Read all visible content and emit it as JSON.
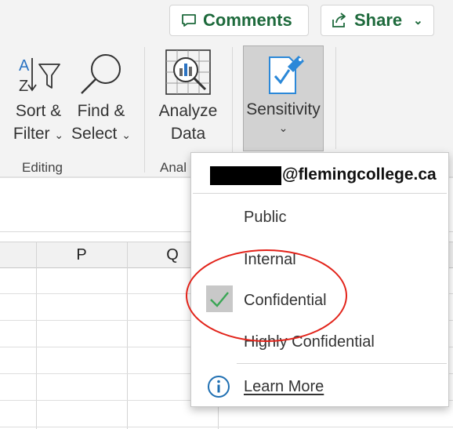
{
  "header": {
    "comments_label": "Comments",
    "share_label": "Share"
  },
  "ribbon": {
    "sort_filter": {
      "line1": "Sort &",
      "line2": "Filter"
    },
    "find_select": {
      "line1": "Find &",
      "line2": "Select"
    },
    "analyze_data": {
      "line1": "Analyze",
      "line2": "Data"
    },
    "sensitivity": {
      "label": "Sensitivity"
    },
    "groups": {
      "editing": "Editing",
      "analysis": "Anal"
    }
  },
  "sheet": {
    "columns": [
      "P",
      "Q"
    ]
  },
  "sensitivity_menu": {
    "email_visible": "@flemingcollege.ca",
    "items": [
      {
        "label": "Public",
        "checked": false
      },
      {
        "label": "Internal",
        "checked": false
      },
      {
        "label": "Confidential",
        "checked": true
      },
      {
        "label": "Highly Confidential",
        "checked": false
      }
    ],
    "learn_more": "Learn More"
  },
  "colors": {
    "accent_green": "#1e6a3c",
    "check_green": "#3aa655",
    "highlight_circle": "#e2231a",
    "info_blue": "#1f6fb2",
    "sensitivity_blue": "#2b88d8"
  }
}
